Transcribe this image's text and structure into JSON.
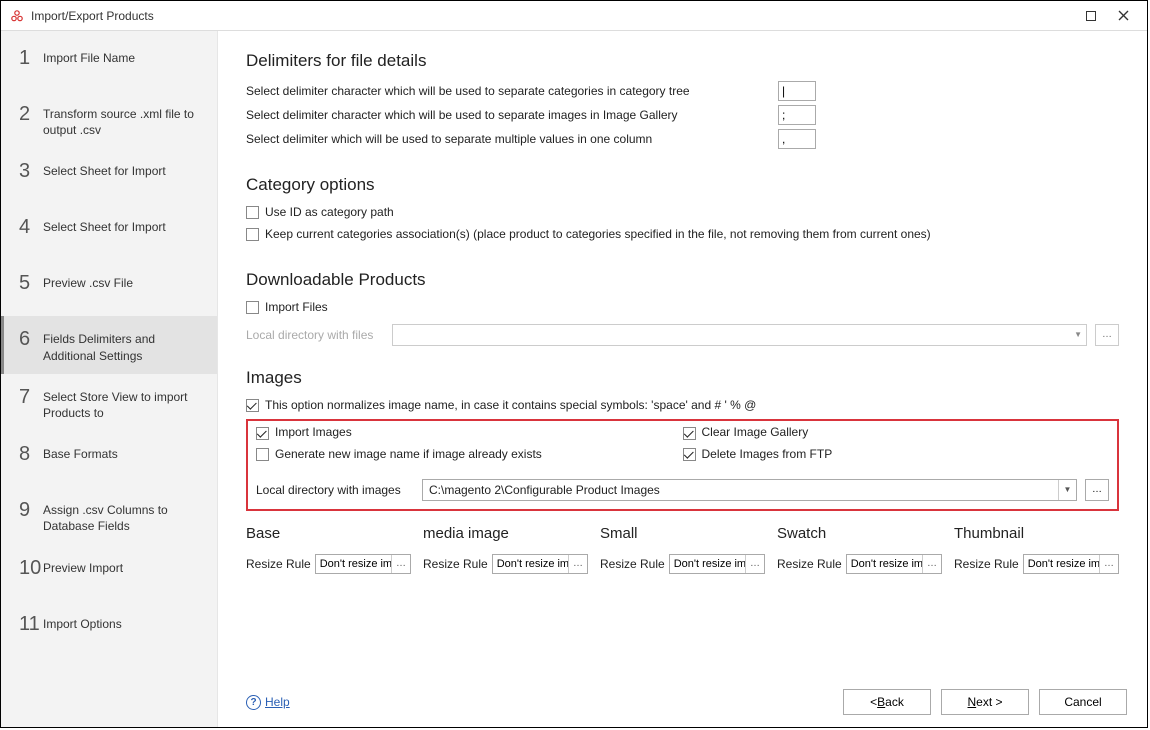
{
  "title": "Import/Export Products",
  "steps": [
    {
      "num": "1",
      "label": "Import File Name"
    },
    {
      "num": "2",
      "label": "Transform source .xml file to output .csv"
    },
    {
      "num": "3",
      "label": "Select Sheet for Import"
    },
    {
      "num": "4",
      "label": "Select Sheet for Import"
    },
    {
      "num": "5",
      "label": "Preview .csv File"
    },
    {
      "num": "6",
      "label": "Fields Delimiters and Additional Settings"
    },
    {
      "num": "7",
      "label": "Select Store View to import Products to"
    },
    {
      "num": "8",
      "label": "Base Formats"
    },
    {
      "num": "9",
      "label": "Assign .csv Columns to Database Fields"
    },
    {
      "num": "10",
      "label": "Preview Import"
    },
    {
      "num": "11",
      "label": "Import Options"
    }
  ],
  "delim_section": "Delimiters for file details",
  "delim_rows": [
    {
      "label": "Select delimiter character which will be used to separate categories in category tree",
      "val": "|"
    },
    {
      "label": "Select delimiter character which will be used to separate images in Image Gallery",
      "val": ";"
    },
    {
      "label": "Select delimiter which will be used to separate multiple values in one column",
      "val": ","
    }
  ],
  "cat_section": "Category options",
  "cat_opts": {
    "use_id": "Use ID as category path",
    "keep": "Keep current categories association(s) (place product to categories specified in the file, not removing them from current ones)"
  },
  "dl_section": "Downloadable Products",
  "dl_import": "Import Files",
  "dl_dir_label": "Local directory with files",
  "img_section": "Images",
  "img_normalize": "This option normalizes image name, in case it contains special symbols: 'space' and # ' % @",
  "img_opts": {
    "import": "Import Images",
    "gen": "Generate new image name if image already exists",
    "clear": "Clear Image Gallery",
    "del_ftp": "Delete Images from FTP"
  },
  "ldir_label": "Local directory with images",
  "ldir_value": "C:\\magento 2\\Configurable Product Images",
  "resize_cols": [
    {
      "title": "Base",
      "rule": "Don't resize imag"
    },
    {
      "title": "media image",
      "rule": "Don't resize imag"
    },
    {
      "title": "Small",
      "rule": "Don't resize imag"
    },
    {
      "title": "Swatch",
      "rule": "Don't resize imag"
    },
    {
      "title": "Thumbnail",
      "rule": "Don't resize imag"
    }
  ],
  "resize_label": "Resize Rule",
  "footer": {
    "help": "Help",
    "back": "< ",
    "back_u": "B",
    "back_rest": "ack",
    "next_u": "N",
    "next_rest": "ext >",
    "cancel": "Cancel"
  }
}
